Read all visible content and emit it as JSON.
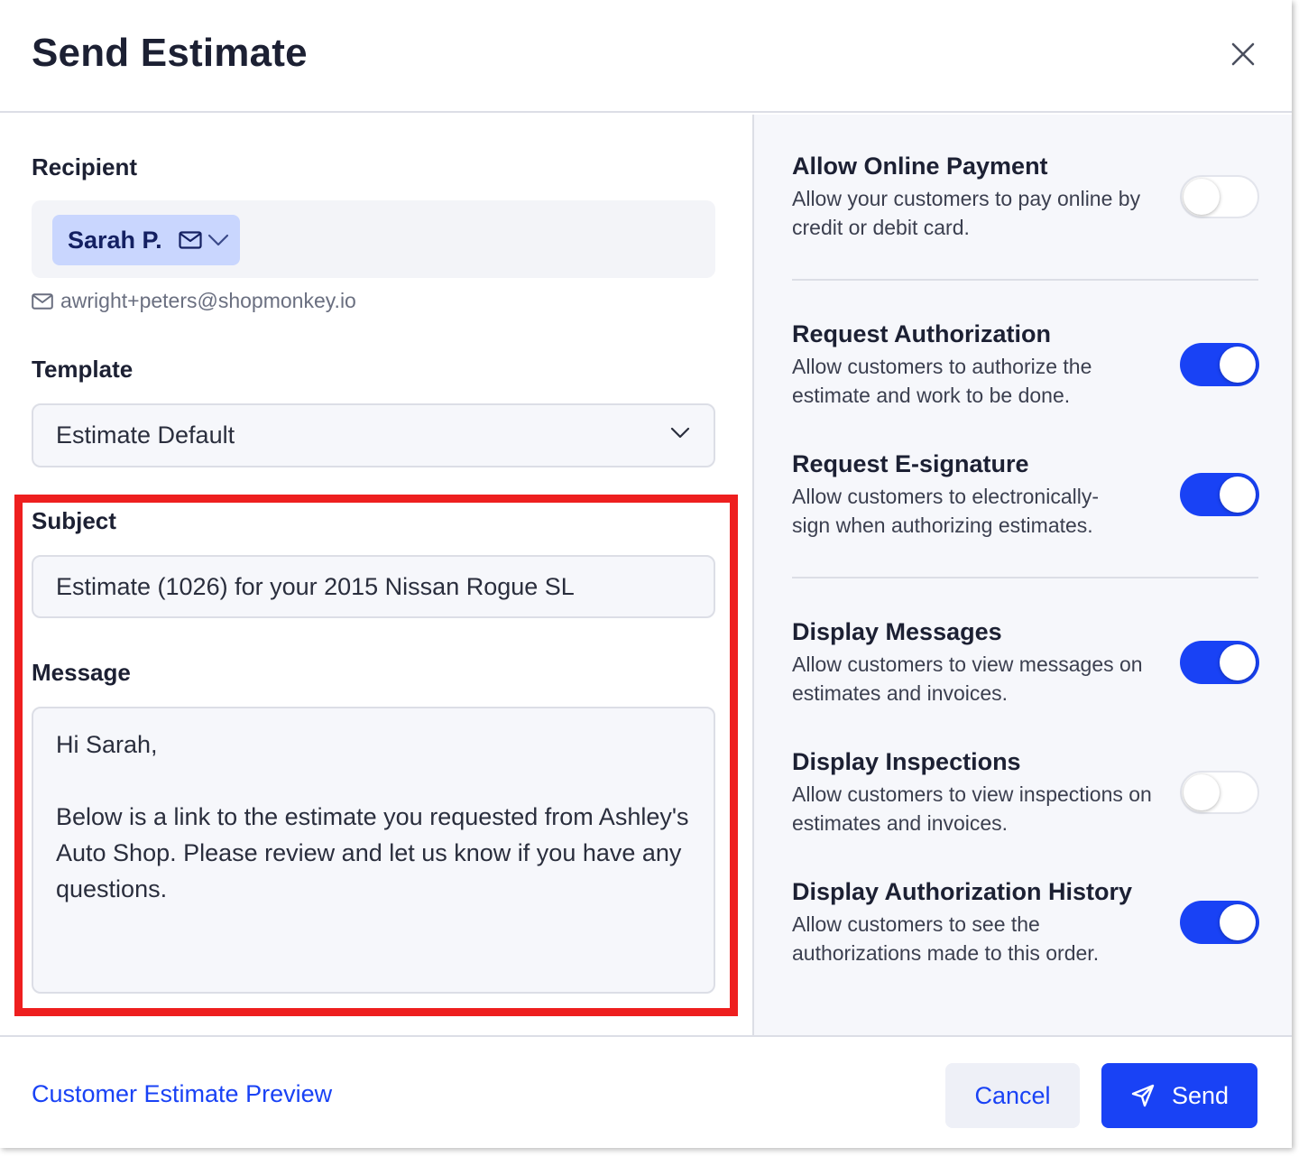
{
  "modal": {
    "title": "Send Estimate"
  },
  "recipient": {
    "label": "Recipient",
    "chip_name": "Sarah P.",
    "email": "awright+peters@shopmonkey.io"
  },
  "template": {
    "label": "Template",
    "selected": "Estimate Default"
  },
  "subject": {
    "label": "Subject",
    "value": "Estimate (1026) for your 2015 Nissan Rogue SL"
  },
  "message": {
    "label": "Message",
    "value": "Hi Sarah,\n\nBelow is a link to the estimate you requested from Ashley's Auto Shop. Please review and let us know if you have any questions."
  },
  "options": [
    {
      "title": "Allow Online Payment",
      "desc": "Allow your customers to pay online by credit or debit card.",
      "enabled": false
    },
    {
      "title": "Request Authorization",
      "desc": "Allow customers to authorize the estimate and work to be done.",
      "enabled": true
    },
    {
      "title": "Request E-signature",
      "desc": "Allow customers to electronically-sign when authorizing estimates.",
      "enabled": true
    },
    {
      "title": "Display Messages",
      "desc": "Allow customers to view messages on estimates and invoices.",
      "enabled": true
    },
    {
      "title": "Display Inspections",
      "desc": "Allow customers to view inspections on estimates and invoices.",
      "enabled": false
    },
    {
      "title": "Display Authorization History",
      "desc": "Allow customers to see the authorizations made to this order.",
      "enabled": true
    }
  ],
  "footer": {
    "preview_link": "Customer Estimate Preview",
    "cancel_label": "Cancel",
    "send_label": "Send"
  },
  "colors": {
    "accent": "#1942f5",
    "highlight": "#ee1f1f",
    "chip_bg": "#c9d6fe"
  },
  "icons": [
    "close-icon",
    "mail-icon",
    "chevron-down-icon",
    "send-icon"
  ]
}
